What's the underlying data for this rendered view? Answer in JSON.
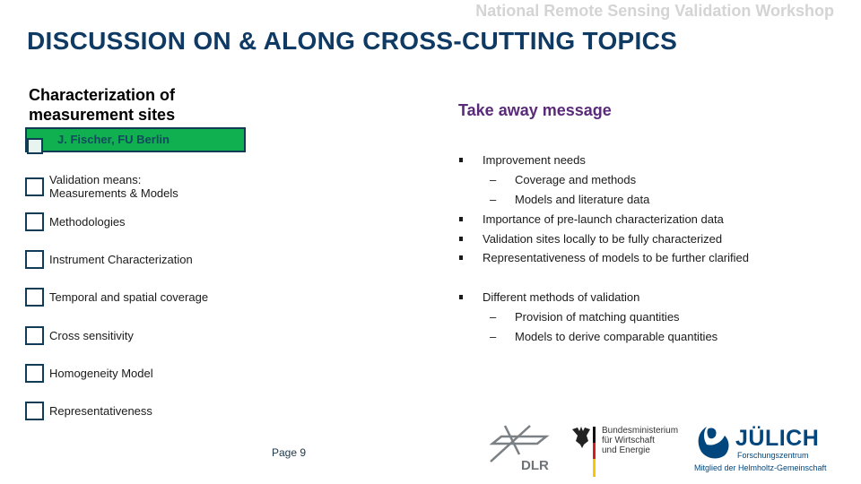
{
  "header": {
    "workshop": "National Remote Sensing Validation Workshop",
    "title": "DISCUSSION ON & ALONG CROSS-CUTTING TOPICS"
  },
  "left": {
    "section_title_line1": "Characterization of",
    "section_title_line2": "measurement sites",
    "presenter": "J. Fischer, FU Berlin",
    "presenter_bar_color": "#10b050",
    "topics": [
      {
        "line1": "Validation means:",
        "line2": "Measurements & Models"
      },
      {
        "line1": "Methodologies"
      },
      {
        "line1": "Instrument Characterization"
      },
      {
        "line1": "Temporal and spatial coverage"
      },
      {
        "line1": "Cross sensitivity"
      },
      {
        "line1": "Homogeneity Model"
      },
      {
        "line1": "Representativeness"
      }
    ]
  },
  "takeaway": {
    "heading": "Take away message",
    "heading_color": "#5a2a7a",
    "items": [
      {
        "level": 1,
        "text": "Improvement needs"
      },
      {
        "level": 2,
        "text": "Coverage and methods"
      },
      {
        "level": 2,
        "text": "Models and literature data"
      },
      {
        "level": 1,
        "text": "Importance of pre-launch characterization data"
      },
      {
        "level": 1,
        "text": "Validation sites locally to be fully characterized"
      },
      {
        "level": 1,
        "text": "Representativeness of models to be further clarified"
      },
      {
        "level": 1,
        "text": "Different methods of validation"
      },
      {
        "level": 2,
        "text": "Provision of matching quantities"
      },
      {
        "level": 2,
        "text": "Models to derive comparable quantities"
      }
    ],
    "dash": "–"
  },
  "footer": {
    "page": "Page 9",
    "dlr": "DLR",
    "bmwi_line1": "Bundesministerium",
    "bmwi_line2": "für Wirtschaft",
    "bmwi_line3": "und Energie",
    "juelich": "JÜLICH",
    "juelich_sub": "Forschungszentrum",
    "juelich_member": "Mitglied der Helmholtz-Gemeinschaft"
  }
}
